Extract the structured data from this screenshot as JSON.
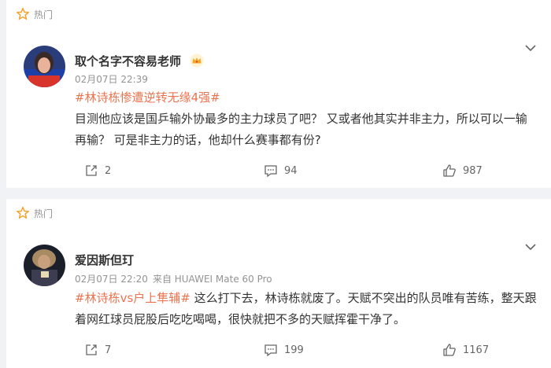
{
  "posts": [
    {
      "hot_label": "热门",
      "author": "取个名字不容易老师",
      "time": "02月07日 22:39",
      "source": "",
      "hashtag": "#林诗栋惨遭逆转无缘4强#",
      "body_line1": "目测他应该是国乒输外协最多的主力球员了吧？ 又或者他其实并非主力，所以可以一输",
      "body_line2": "再输？ 可是非主力的话，他却什么赛事都有份?",
      "reposts": "2",
      "comments": "94",
      "likes": "987"
    },
    {
      "hot_label": "热门",
      "author": "爱因斯但玎",
      "time": "02月07日 22:20",
      "source": "来自 HUAWEI Mate 60 Pro",
      "hashtag": "#林诗栋vs户上隼辅#",
      "body_line1": " 这么打下去，林诗栋就废了。天赋不突出的队员唯有苦练，整天跟",
      "body_line2": "着网红球员屁股后吃吃喝喝，很快就把不多的天赋挥霍干净了。",
      "reposts": "7",
      "comments": "199",
      "likes": "1167"
    }
  ],
  "colors": {
    "hashtag": "#eb7350",
    "hot_icon": "#f4a433",
    "meta": "#939393"
  },
  "icons": [
    "hot-fire-icon",
    "chevron-down-icon",
    "vip-crown-icon",
    "repost-icon",
    "comment-icon",
    "like-icon"
  ]
}
